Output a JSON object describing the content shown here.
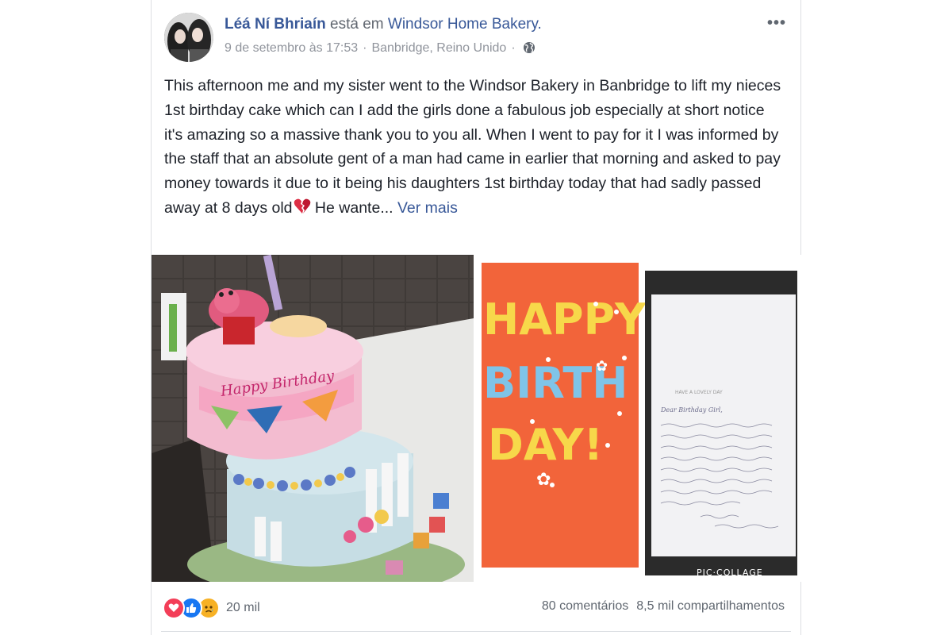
{
  "post": {
    "author": "Léá Ní Bhriaín",
    "verb": "está em",
    "location": "Windsor Home Bakery.",
    "timestamp": "9 de setembro às 17:53",
    "separator": "·",
    "place": "Banbridge, Reino Unido",
    "text": "This afternoon me and my sister went to the Windsor Bakery in Banbridge to lift my nieces 1st birthday cake which can I add the girls done a fabulous job especially at short notice it's amazing so a massive thank you to you all. When I went to pay for it I was informed by the staff that an absolute gent of a man had came in earlier that morning and asked to pay money towards it due to it being his daughters 1st birthday today that had sadly passed away at 8 days old",
    "text_tail": " He wante...",
    "see_more": "Ver mais",
    "more_icon": "•••"
  },
  "photos": {
    "cake_text": "Happy Birthday",
    "card": {
      "line1": "HAPPY",
      "line2": "BIRTH",
      "line3": "DAY!"
    },
    "note": {
      "header": "HAVE A LOVELY DAY",
      "greeting": "Dear Birthday Girl,"
    },
    "watermark": "PIC·COLLAGE"
  },
  "footer": {
    "reaction_count": "20 mil",
    "comments": "80 comentários",
    "shares": "8,5 mil compartilhamentos"
  },
  "colors": {
    "link": "#385898",
    "text": "#1d2129",
    "meta": "#90949c",
    "card_orange": "#f2643a"
  }
}
